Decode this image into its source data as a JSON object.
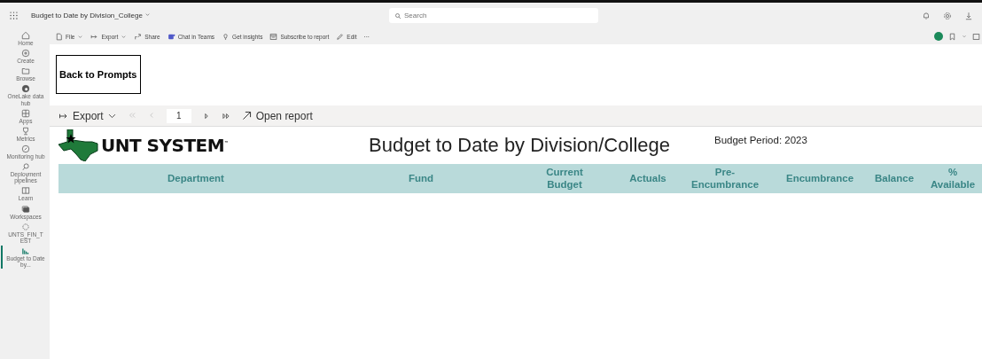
{
  "topbar": {
    "title": "Budget to Date by Division_College",
    "search": {
      "placeholder": "Search"
    }
  },
  "sidebar": {
    "items": [
      {
        "label": "Home",
        "selected": false
      },
      {
        "label": "Create",
        "selected": false
      },
      {
        "label": "Browse",
        "selected": false
      },
      {
        "label": "OneLake data hub",
        "selected": false
      },
      {
        "label": "Apps",
        "selected": false
      },
      {
        "label": "Metrics",
        "selected": false
      },
      {
        "label": "Monitoring hub",
        "selected": false
      },
      {
        "label": "Deployment pipelines",
        "selected": false
      },
      {
        "label": "Learn",
        "selected": false
      },
      {
        "label": "Workspaces",
        "selected": false
      },
      {
        "label": "UNTS_FIN_T EST",
        "selected": false
      },
      {
        "label": "Budget to Date by...",
        "selected": true
      }
    ]
  },
  "command_bar": {
    "items": [
      {
        "label": "File",
        "dropdown": true
      },
      {
        "label": "Export",
        "dropdown": true
      },
      {
        "label": "Share",
        "dropdown": false
      },
      {
        "label": "Chat in Teams",
        "dropdown": false
      },
      {
        "label": "Get insights",
        "dropdown": false
      },
      {
        "label": "Subscribe to report",
        "dropdown": false
      },
      {
        "label": "Edit",
        "dropdown": false
      },
      {
        "label": "···",
        "dropdown": false
      }
    ]
  },
  "back_button": "Back to Prompts",
  "report_toolbar": {
    "export": "Export",
    "page": "1",
    "open_report": "Open report"
  },
  "report": {
    "logo_text": "UNT SYSTEM$^{™}$",
    "title": "Budget to Date by Division/College",
    "period": "Budget Period: 2023",
    "columns": [
      "Department",
      "Fund",
      "Current Budget",
      "Actuals",
      "Pre-Encumbrance",
      "Encumbrance",
      "Balance",
      "% Available"
    ]
  }
}
